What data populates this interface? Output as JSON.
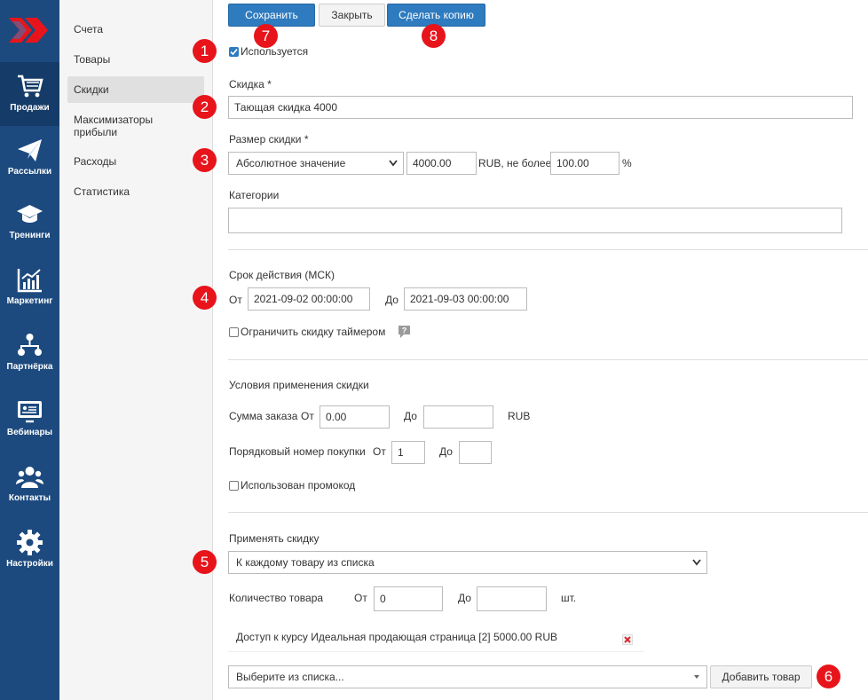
{
  "nav": {
    "items": [
      {
        "label": "Продажи",
        "icon": "cart-icon"
      },
      {
        "label": "Рассылки",
        "icon": "paper-plane-icon"
      },
      {
        "label": "Тренинги",
        "icon": "graduation-cap-icon"
      },
      {
        "label": "Маркетинг",
        "icon": "chart-icon"
      },
      {
        "label": "Партнёрка",
        "icon": "network-icon"
      },
      {
        "label": "Вебинары",
        "icon": "monitor-icon"
      },
      {
        "label": "Контакты",
        "icon": "users-icon"
      },
      {
        "label": "Настройки",
        "icon": "gear-icon"
      }
    ],
    "active": "Продажи"
  },
  "submenu": {
    "items": [
      "Счета",
      "Товары",
      "Скидки",
      "Максимизаторы прибыли",
      "Расходы",
      "Статистика"
    ],
    "active": "Скидки"
  },
  "toolbar": {
    "save": "Сохранить",
    "close": "Закрыть",
    "copy": "Сделать копию"
  },
  "form": {
    "used_label": "Используется",
    "used_checked": true,
    "discount_label": "Скидка *",
    "discount_value": "Тающая скидка 4000",
    "size_label": "Размер скидки *",
    "size_type": "Абсолютное значение",
    "size_amount": "4000.00",
    "size_currency_text": "RUB, не более",
    "size_max": "100.00",
    "size_percent": "%",
    "categories_label": "Категории",
    "categories_value": "",
    "validity_label": "Срок действия (МСК)",
    "from_label": "От",
    "from_value": "2021-09-02 00:00:00",
    "to_label": "До",
    "to_value": "2021-09-03 00:00:00",
    "timer_label": "Ограничить скидку таймером",
    "timer_checked": false,
    "conditions_label": "Условия применения скидки",
    "order_sum_label": "Сумма заказа",
    "order_from_label": "От",
    "order_from_value": "0.00",
    "order_to_label": "До",
    "order_to_value": "",
    "order_currency": "RUB",
    "purchase_num_label": "Порядковый номер покупки",
    "purchase_from_label": "От",
    "purchase_from_value": "1",
    "purchase_to_label": "До",
    "purchase_to_value": "",
    "promo_label": "Использован промокод",
    "promo_checked": false,
    "apply_label": "Применять скидку",
    "apply_value": "К каждому товару из списка",
    "qty_label": "Количество товара",
    "qty_from_label": "От",
    "qty_from_value": "0",
    "qty_to_label": "До",
    "qty_to_value": "",
    "qty_unit": "шт.",
    "product_item": "Доступ к курсу Идеальная продающая страница [2] 5000.00 RUB",
    "product_select_placeholder": "Выберите из списка...",
    "add_product": "Добавить товар"
  },
  "badges": [
    "1",
    "2",
    "3",
    "4",
    "5",
    "6",
    "7",
    "8"
  ],
  "colors": {
    "nav_bg": "#1d4a7e",
    "primary": "#2f7bbf",
    "badge": "#e8141b"
  }
}
